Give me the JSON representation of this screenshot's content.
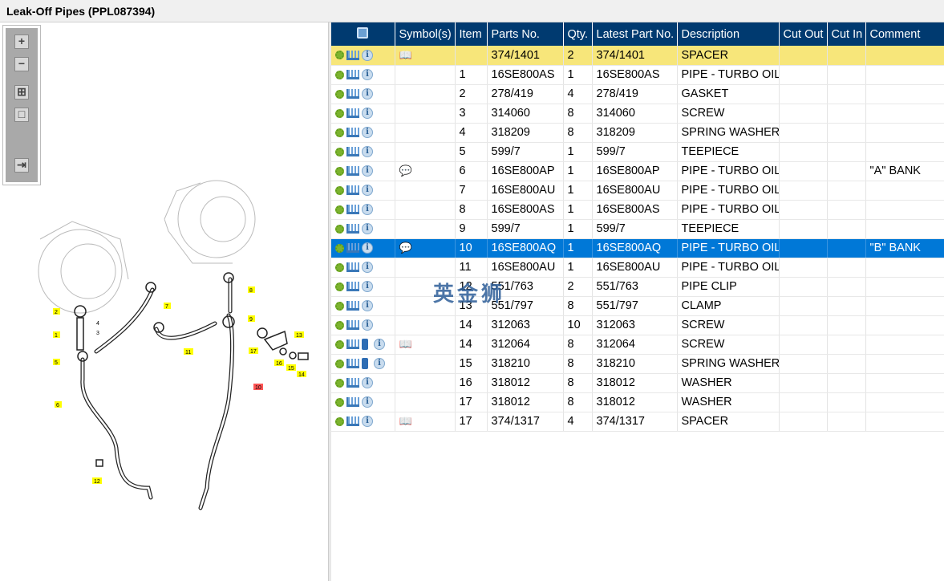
{
  "window": {
    "title": "Leak-Off Pipes (PPL087394)"
  },
  "toolbar": {
    "zoom_in": "+",
    "zoom_out": "−",
    "fit": "⊞",
    "actual": "□",
    "export": "⇥"
  },
  "watermark": "英金狮",
  "columns": [
    "",
    "Symbol(s)",
    "Item",
    "Parts No.",
    "Qty.",
    "Latest Part No.",
    "Description",
    "Cut Out",
    "Cut In",
    "Comment"
  ],
  "diagram_labels": [
    "1",
    "2",
    "3",
    "4",
    "5",
    "6",
    "7",
    "8",
    "9",
    "10",
    "11",
    "12",
    "13",
    "14",
    "15",
    "16",
    "17"
  ],
  "rows": [
    {
      "book": false,
      "sym": "book-search",
      "item": "",
      "part": "374/1401",
      "qty": "2",
      "latest": "374/1401",
      "desc": "SPACER",
      "comment": "",
      "state": "hl"
    },
    {
      "book": false,
      "sym": "",
      "item": "1",
      "part": "16SE800AS",
      "qty": "1",
      "latest": "16SE800AS",
      "desc": "PIPE - TURBO OIL L",
      "comment": ""
    },
    {
      "book": false,
      "sym": "",
      "item": "2",
      "part": "278/419",
      "qty": "4",
      "latest": "278/419",
      "desc": "GASKET",
      "comment": ""
    },
    {
      "book": false,
      "sym": "",
      "item": "3",
      "part": "314060",
      "qty": "8",
      "latest": "314060",
      "desc": "SCREW",
      "comment": ""
    },
    {
      "book": false,
      "sym": "",
      "item": "4",
      "part": "318209",
      "qty": "8",
      "latest": "318209",
      "desc": "SPRING WASHER",
      "comment": ""
    },
    {
      "book": false,
      "sym": "",
      "item": "5",
      "part": "599/7",
      "qty": "1",
      "latest": "599/7",
      "desc": "TEEPIECE",
      "comment": ""
    },
    {
      "book": false,
      "sym": "comment",
      "item": "6",
      "part": "16SE800AP",
      "qty": "1",
      "latest": "16SE800AP",
      "desc": "PIPE - TURBO OIL L",
      "comment": "\"A\" BANK"
    },
    {
      "book": false,
      "sym": "",
      "item": "7",
      "part": "16SE800AU",
      "qty": "1",
      "latest": "16SE800AU",
      "desc": "PIPE - TURBO OIL L",
      "comment": ""
    },
    {
      "book": false,
      "sym": "",
      "item": "8",
      "part": "16SE800AS",
      "qty": "1",
      "latest": "16SE800AS",
      "desc": "PIPE - TURBO OIL L",
      "comment": ""
    },
    {
      "book": false,
      "sym": "",
      "item": "9",
      "part": "599/7",
      "qty": "1",
      "latest": "599/7",
      "desc": "TEEPIECE",
      "comment": ""
    },
    {
      "book": false,
      "sym": "comment",
      "item": "10",
      "part": "16SE800AQ",
      "qty": "1",
      "latest": "16SE800AQ",
      "desc": "PIPE - TURBO OIL L",
      "comment": "\"B\" BANK",
      "state": "sel"
    },
    {
      "book": false,
      "sym": "",
      "item": "11",
      "part": "16SE800AU",
      "qty": "1",
      "latest": "16SE800AU",
      "desc": "PIPE - TURBO OIL L",
      "comment": ""
    },
    {
      "book": false,
      "sym": "",
      "item": "12",
      "part": "551/763",
      "qty": "2",
      "latest": "551/763",
      "desc": "PIPE CLIP",
      "comment": ""
    },
    {
      "book": false,
      "sym": "",
      "item": "13",
      "part": "551/797",
      "qty": "8",
      "latest": "551/797",
      "desc": "CLAMP",
      "comment": ""
    },
    {
      "book": false,
      "sym": "",
      "item": "14",
      "part": "312063",
      "qty": "10",
      "latest": "312063",
      "desc": "SCREW",
      "comment": ""
    },
    {
      "book": true,
      "sym": "book-search",
      "item": "14",
      "part": "312064",
      "qty": "8",
      "latest": "312064",
      "desc": "SCREW",
      "comment": ""
    },
    {
      "book": true,
      "sym": "",
      "item": "15",
      "part": "318210",
      "qty": "8",
      "latest": "318210",
      "desc": "SPRING WASHER",
      "comment": ""
    },
    {
      "book": false,
      "sym": "",
      "item": "16",
      "part": "318012",
      "qty": "8",
      "latest": "318012",
      "desc": "WASHER",
      "comment": ""
    },
    {
      "book": false,
      "sym": "",
      "item": "17",
      "part": "318012",
      "qty": "8",
      "latest": "318012",
      "desc": "WASHER",
      "comment": ""
    },
    {
      "book": false,
      "sym": "book-search",
      "item": "17",
      "part": "374/1317",
      "qty": "4",
      "latest": "374/1317",
      "desc": "SPACER",
      "comment": ""
    }
  ]
}
